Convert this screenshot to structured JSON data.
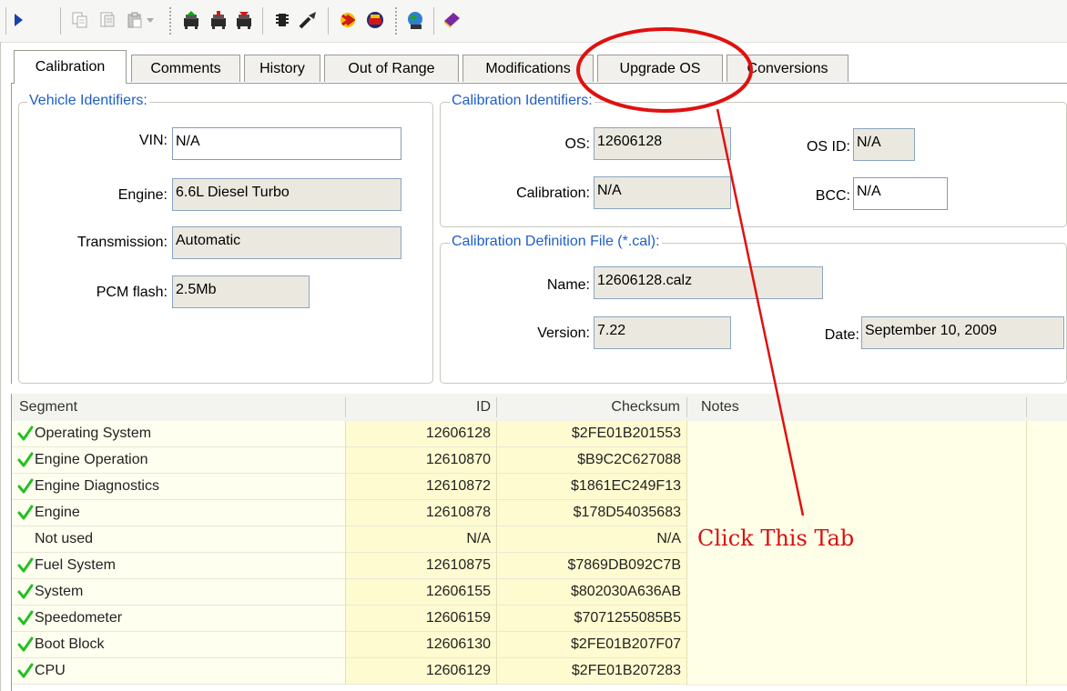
{
  "toolbar": {
    "buttons": [
      {
        "icon": "play-icon"
      },
      {
        "icon": "copy-icon"
      },
      {
        "icon": "copy-table-icon"
      },
      {
        "icon": "paste-icon"
      },
      {
        "icon": "read-vehicle-icon"
      },
      {
        "icon": "write-vehicle-icon"
      },
      {
        "icon": "write-calibration-icon"
      },
      {
        "icon": "chip-icon"
      },
      {
        "icon": "tools-icon"
      },
      {
        "icon": "flash-icon"
      },
      {
        "icon": "stop-icon"
      },
      {
        "icon": "globe-icon"
      },
      {
        "icon": "help-book-icon"
      }
    ]
  },
  "tabs": [
    {
      "label": "Calibration",
      "active": true
    },
    {
      "label": "Comments"
    },
    {
      "label": "History"
    },
    {
      "label": "Out of Range"
    },
    {
      "label": "Modifications"
    },
    {
      "label": "Upgrade OS"
    },
    {
      "label": "Conversions"
    }
  ],
  "vehicle": {
    "title": "Vehicle Identifiers:",
    "vin_label": "VIN:",
    "vin": "N/A",
    "engine_label": "Engine:",
    "engine": "6.6L Diesel Turbo",
    "transmission_label": "Transmission:",
    "transmission": "Automatic",
    "pcm_label": "PCM flash:",
    "pcm": "2.5Mb"
  },
  "calibration_ids": {
    "title": "Calibration Identifiers:",
    "os_label": "OS:",
    "os": "12606128",
    "osid_label": "OS ID:",
    "osid": "N/A",
    "cal_label": "Calibration:",
    "cal": "N/A",
    "bcc_label": "BCC:",
    "bcc": "N/A"
  },
  "cal_file": {
    "title": "Calibration Definition File (*.cal):",
    "name_label": "Name:",
    "name": "12606128.calz",
    "version_label": "Version:",
    "version": "7.22",
    "date_label": "Date:",
    "date": "September 10, 2009"
  },
  "table": {
    "headers": {
      "segment": "Segment",
      "id": "ID",
      "checksum": "Checksum",
      "notes": "Notes"
    },
    "rows": [
      {
        "check": true,
        "segment": "Operating System",
        "id": "12606128",
        "checksum": "$2FE01B201553",
        "notes": ""
      },
      {
        "check": true,
        "segment": "Engine Operation",
        "id": "12610870",
        "checksum": "$B9C2C627088",
        "notes": ""
      },
      {
        "check": true,
        "segment": "Engine Diagnostics",
        "id": "12610872",
        "checksum": "$1861EC249F13",
        "notes": ""
      },
      {
        "check": true,
        "segment": "Engine",
        "id": "12610878",
        "checksum": "$178D54035683",
        "notes": ""
      },
      {
        "check": false,
        "segment": "Not used",
        "id": "N/A",
        "checksum": "N/A",
        "notes": ""
      },
      {
        "check": true,
        "segment": "Fuel System",
        "id": "12610875",
        "checksum": "$7869DB092C7B",
        "notes": ""
      },
      {
        "check": true,
        "segment": "System",
        "id": "12606155",
        "checksum": "$802030A636AB",
        "notes": ""
      },
      {
        "check": true,
        "segment": "Speedometer",
        "id": "12606159",
        "checksum": "$7071255085B5",
        "notes": ""
      },
      {
        "check": true,
        "segment": "Boot Block",
        "id": "12606130",
        "checksum": "$2FE01B207F07",
        "notes": ""
      },
      {
        "check": true,
        "segment": "CPU",
        "id": "12606129",
        "checksum": "$2FE01B207283",
        "notes": ""
      }
    ]
  },
  "annotation": {
    "text": "Click This Tab",
    "color": "#d81010"
  },
  "colors": {
    "group_title": "#1f5ec6",
    "row_yellow": "#fffbd0",
    "check_green": "#22c022"
  }
}
